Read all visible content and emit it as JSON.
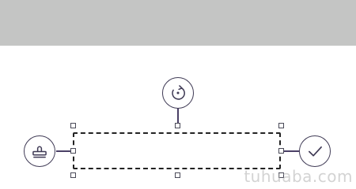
{
  "watermark": {
    "text": "tuhuaba.com"
  },
  "colors": {
    "header_band": "#c4c5c4",
    "icon_stroke": "#3f3a55",
    "box_border": "#222222",
    "handle_border": "#4a4a58"
  },
  "icons": {
    "top": "rotate-icon",
    "left": "stamp-icon",
    "right": "checkmark-icon"
  }
}
